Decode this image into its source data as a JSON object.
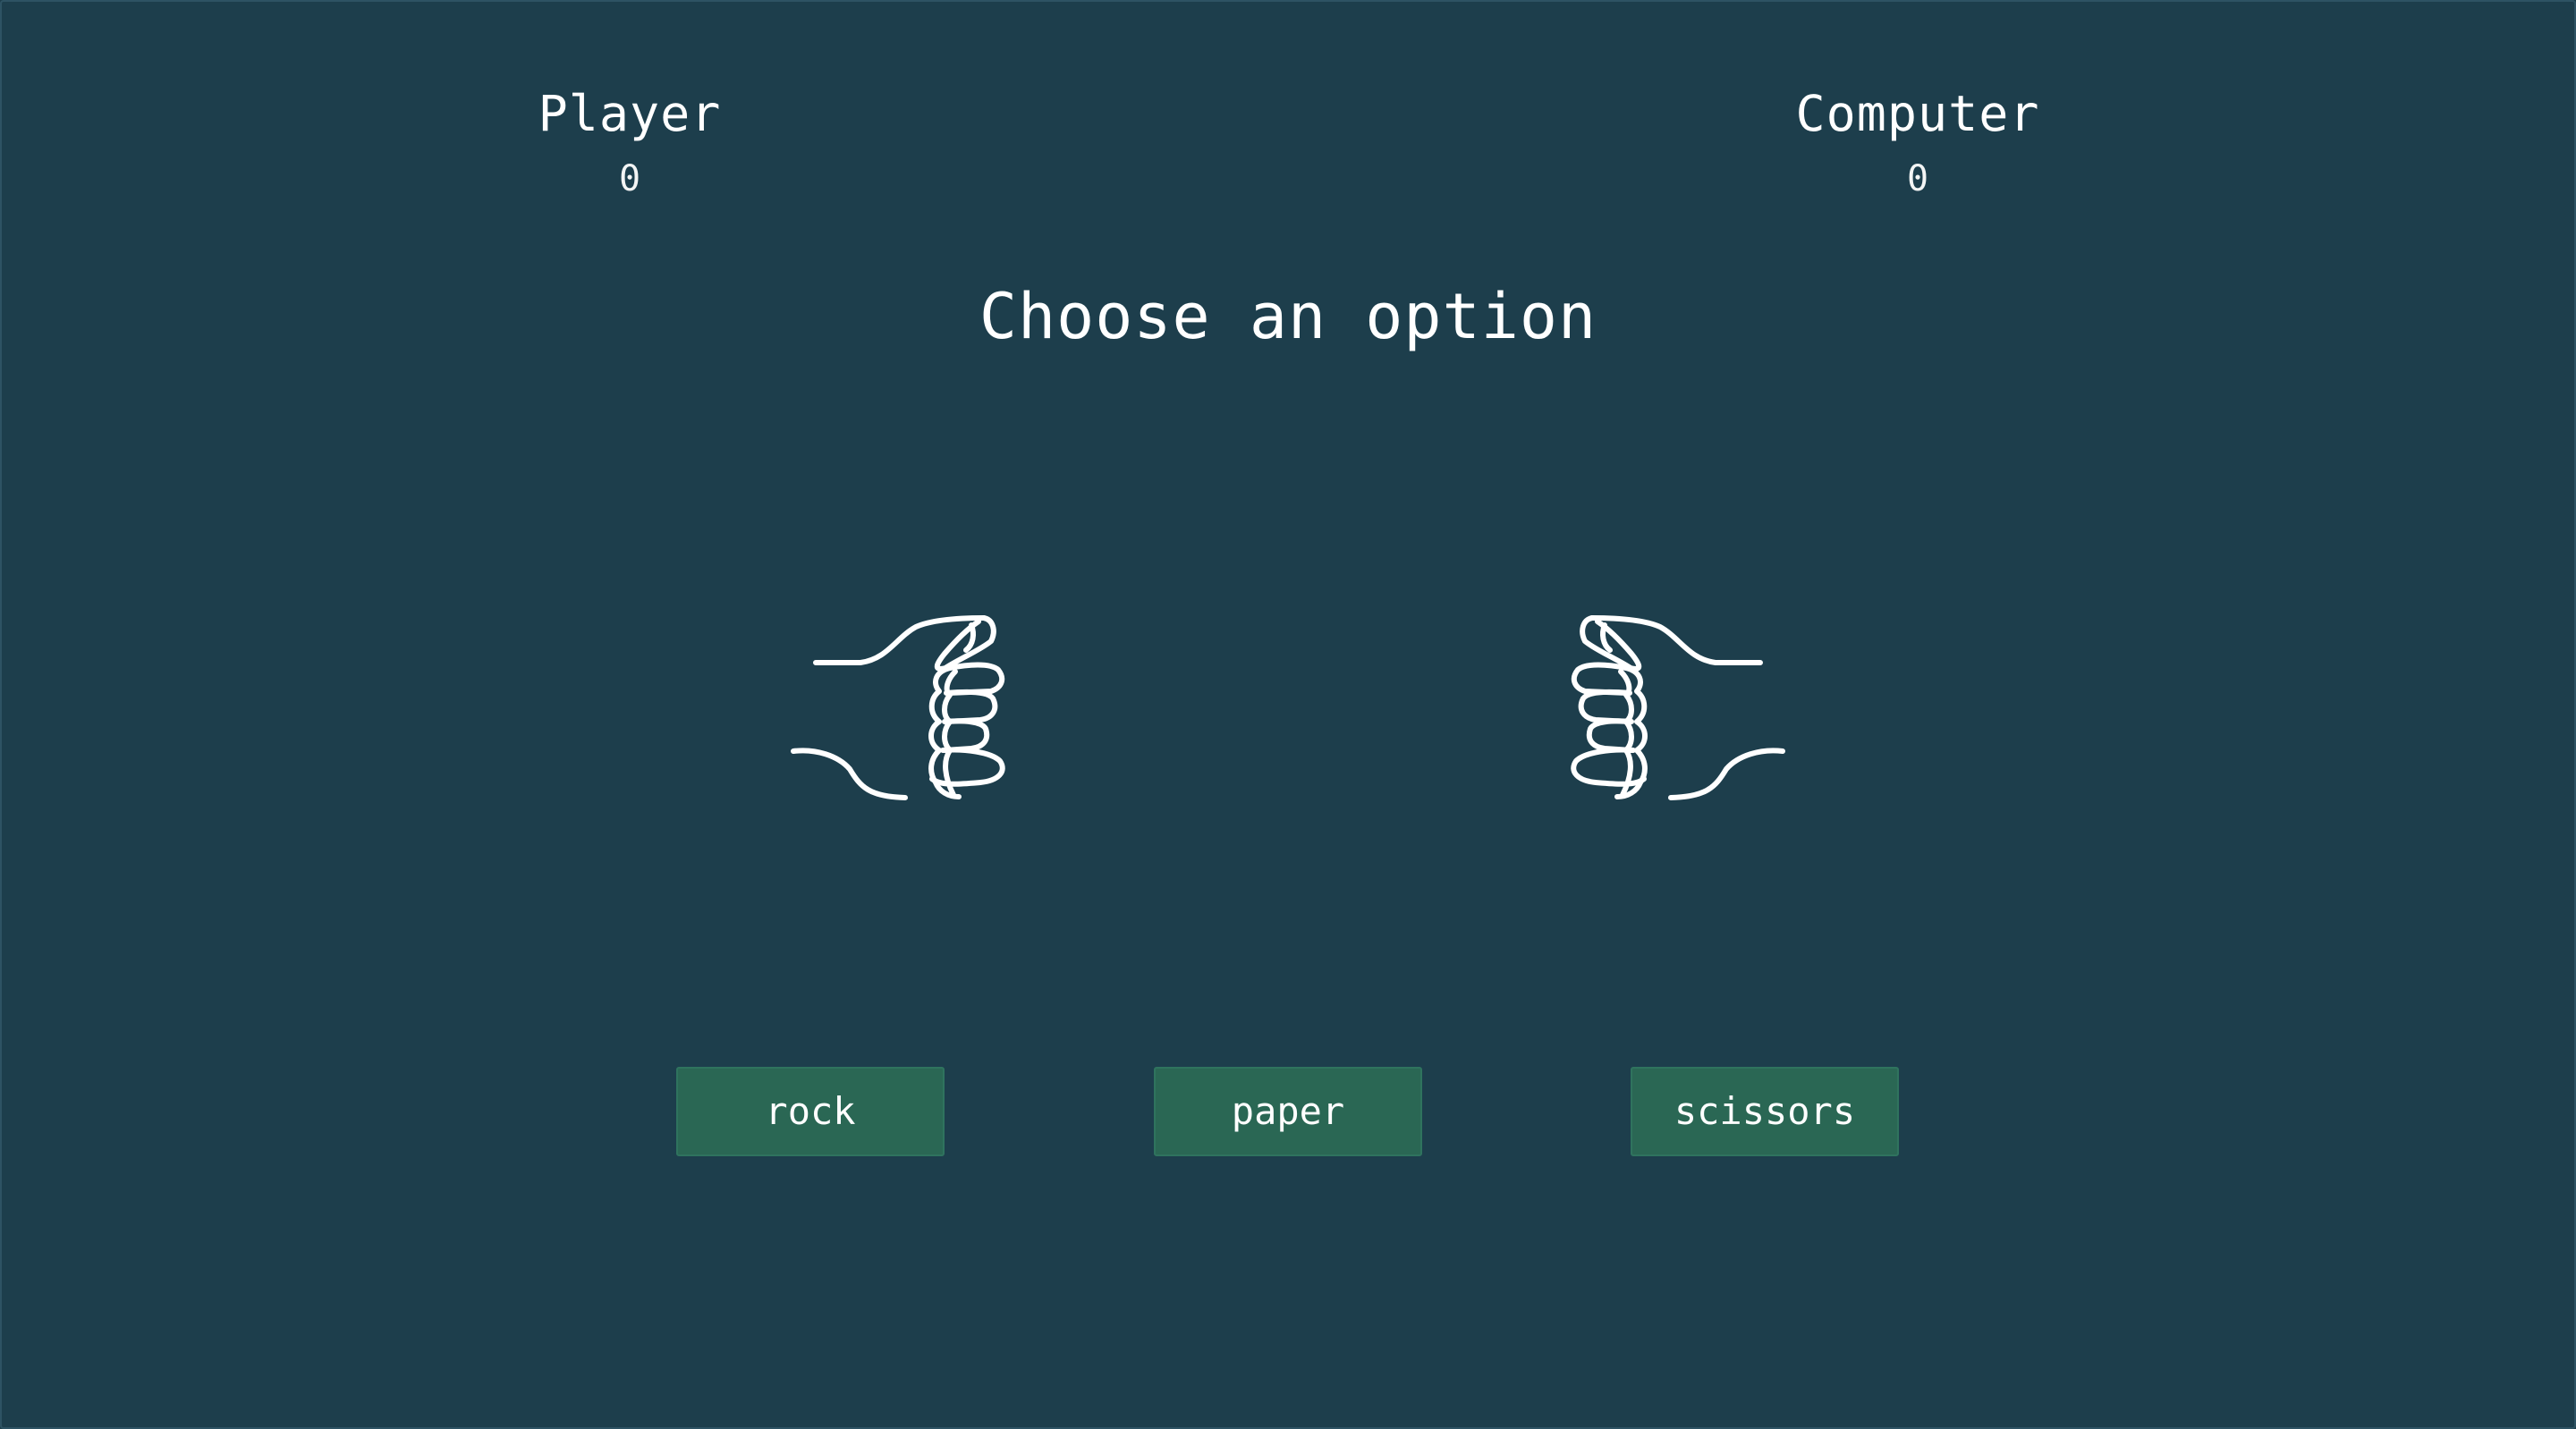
{
  "scoreboard": {
    "player": {
      "name": "Player",
      "score": "0"
    },
    "computer": {
      "name": "Computer",
      "score": "0"
    }
  },
  "message": "Choose an option",
  "hands": {
    "player": "rock-hand-icon",
    "computer": "rock-hand-icon"
  },
  "buttons": {
    "rock": "rock",
    "paper": "paper",
    "scissors": "scissors"
  },
  "colors": {
    "background": "#1d3e4c",
    "button": "#2a6754",
    "text": "#ffffff"
  }
}
